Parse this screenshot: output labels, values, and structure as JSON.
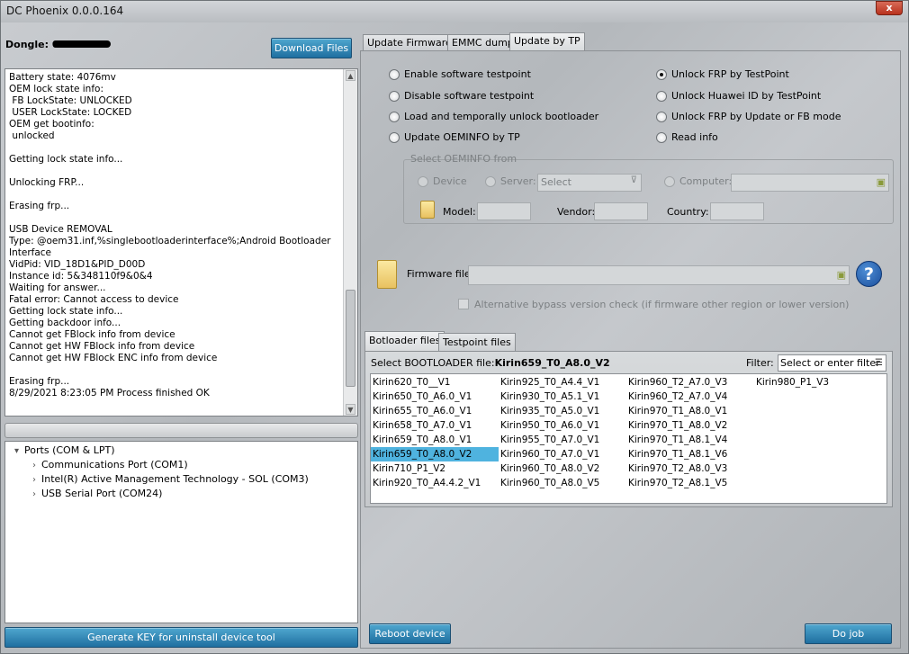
{
  "window": {
    "title": "DC Phoenix 0.0.0.164",
    "close_label": "x"
  },
  "left": {
    "dongle_label": "Dongle: 0",
    "download_button": "Download Files",
    "log_lines": [
      "Battery state: 4076mv",
      "OEM lock state info:",
      " FB LockState: UNLOCKED",
      " USER LockState: LOCKED",
      "OEM get bootinfo:",
      " unlocked",
      "",
      "Getting lock state info...",
      "",
      "Unlocking FRP...",
      "",
      "Erasing frp...",
      "",
      "USB Device REMOVAL",
      "Type: @oem31.inf,%singlebootloaderinterface%;Android Bootloader",
      "Interface",
      "VidPid: VID_18D1&PID_D00D",
      "Instance id: 5&348110f9&0&4",
      "Waiting for answer...",
      "Fatal error: Cannot access to device",
      "Getting lock state info...",
      "Getting backdoor info...",
      "Cannot get FBlock info from device",
      "Cannot get HW FBlock info from device",
      "Cannot get HW FBlock ENC info from device",
      "",
      "Erasing frp...",
      "8/29/2021 8:23:05 PM Process finished OK"
    ],
    "tree": {
      "root": "Ports (COM & LPT)",
      "children": [
        "Communications Port (COM1)",
        "Intel(R) Active Management Technology - SOL (COM3)",
        "USB Serial Port (COM24)"
      ]
    },
    "generate_key_button": "Generate KEY for uninstall device tool"
  },
  "tabs": [
    "Update Firmware",
    "EMMC dump",
    "Update by TP"
  ],
  "options_left": [
    "Enable software testpoint",
    "Disable software testpoint",
    "Load and temporally unlock bootloader",
    "Update OEMINFO by TP"
  ],
  "options_right": [
    "Unlock FRP by TestPoint",
    "Unlock Huawei ID by TestPoint",
    "Unlock FRP by Update or FB mode",
    "Read info"
  ],
  "oeminfo": {
    "title": "Select OEMINFO from",
    "device_label": "Device",
    "server_label": "Server:",
    "server_select": "Select",
    "computer_label": "Computer:",
    "model_label": "Model:",
    "vendor_label": "Vendor:",
    "country_label": "Country:"
  },
  "firmware": {
    "label": "Firmware file:",
    "help": "?",
    "alt_check": "Alternative bypass version check (if firmware other region or lower version)"
  },
  "file_tabs": [
    "Botloader files",
    "Testpoint files"
  ],
  "bootloader": {
    "select_label": "Select BOOTLOADER file:",
    "selected_value": "Kirin659_T0_A8.0_V2",
    "filter_label": "Filter:",
    "filter_placeholder": "Select or enter filter",
    "columns": [
      [
        "Kirin620_T0__V1",
        "Kirin650_T0_A6.0_V1",
        "Kirin655_T0_A6.0_V1",
        "Kirin658_T0_A7.0_V1",
        "Kirin659_T0_A8.0_V1",
        "Kirin659_T0_A8.0_V2",
        "Kirin710_P1_V2",
        "Kirin920_T0_A4.4.2_V1"
      ],
      [
        "Kirin925_T0_A4.4_V1",
        "Kirin930_T0_A5.1_V1",
        "Kirin935_T0_A5.0_V1",
        "Kirin950_T0_A6.0_V1",
        "Kirin955_T0_A7.0_V1",
        "Kirin960_T0_A7.0_V1",
        "Kirin960_T0_A8.0_V2",
        "Kirin960_T0_A8.0_V5"
      ],
      [
        "Kirin960_T2_A7.0_V3",
        "Kirin960_T2_A7.0_V4",
        "Kirin970_T1_A8.0_V1",
        "Kirin970_T1_A8.0_V2",
        "Kirin970_T1_A8.1_V4",
        "Kirin970_T1_A8.1_V6",
        "Kirin970_T2_A8.0_V3",
        "Kirin970_T2_A8.1_V5"
      ],
      [
        "Kirin980_P1_V3"
      ]
    ]
  },
  "bottom": {
    "reboot_button": "Reboot device",
    "do_job_button": "Do job"
  }
}
